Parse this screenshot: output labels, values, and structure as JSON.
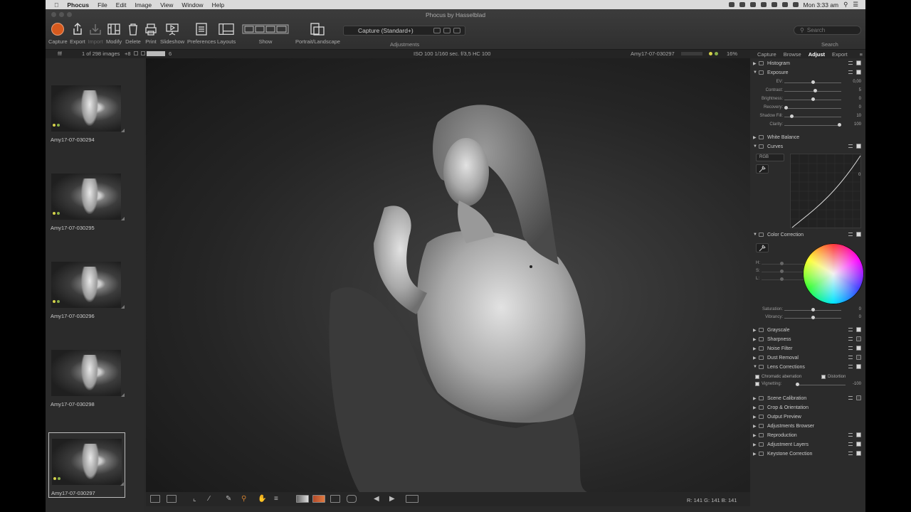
{
  "menubar": {
    "apple": "",
    "items": [
      "Phocus",
      "File",
      "Edit",
      "Image",
      "View",
      "Window",
      "Help"
    ],
    "clock": "Mon 3:33 am"
  },
  "window": {
    "title": "Phocus by Hasselblad"
  },
  "toolbar": {
    "capture": "Capture",
    "export": "Export",
    "import": "Import",
    "modify": "Modify",
    "delete": "Delete",
    "print": "Print",
    "slideshow": "Slideshow",
    "preferences": "Preferences",
    "layouts": "Layouts",
    "show": "Show",
    "portrait_landscape": "Portrait/Landscape",
    "preset": "Capture (Standard+)",
    "adjustments": "Adjustments",
    "search_placeholder": "Search",
    "search_label": "Search",
    "accent": "#d75a1e"
  },
  "infobar": {
    "folder": "fff",
    "count": "1 of 298 images",
    "plus": "+8",
    "six": "6",
    "exif": "ISO 100  1/160 sec. f/3,5  HC 100",
    "filename": "Amy17-07-030297",
    "zoom": "16%"
  },
  "browser": {
    "thumbs": [
      {
        "name": "Amy17-07-030294"
      },
      {
        "name": "Amy17-07-030295"
      },
      {
        "name": "Amy17-07-030296"
      },
      {
        "name": "Amy17-07-030298"
      },
      {
        "name": "Amy17-07-030297"
      }
    ]
  },
  "readout": {
    "r": "141",
    "g": "141",
    "b": "141",
    "text": "R: 141  G: 141  B: 141"
  },
  "panel": {
    "tabs": [
      "Capture",
      "Browse",
      "Adjust",
      "Export"
    ],
    "histogram": "Histogram",
    "exposure": "Exposure",
    "sliders": [
      {
        "name": "EV:",
        "value": "0,00",
        "pos": 0.5
      },
      {
        "name": "Contrast:",
        "value": "5",
        "pos": 0.55
      },
      {
        "name": "Brightness:",
        "value": "0",
        "pos": 0.5
      },
      {
        "name": "Recovery:",
        "value": "0",
        "pos": 0.0
      },
      {
        "name": "Shadow Fill:",
        "value": "10",
        "pos": 0.1
      },
      {
        "name": "Clarity:",
        "value": "100",
        "pos": 1.0
      }
    ],
    "white_balance": "White Balance",
    "curves": "Curves",
    "curve_channel": "RGB",
    "curve_zero": "0",
    "color_correction": "Color Correction",
    "hsl": [
      "H:",
      "S:",
      "L:"
    ],
    "saturation": {
      "name": "Saturation:",
      "value": "0",
      "pos": 0.5
    },
    "vibrancy": {
      "name": "Vibrancy:",
      "value": "0",
      "pos": 0.5
    },
    "grayscale": "Grayscale",
    "sharpness": "Sharpness",
    "noise_filter": "Noise Filter",
    "dust_removal": "Dust Removal",
    "lens_corrections": "Lens Corrections",
    "chromatic": "Chromatic aberration",
    "distortion": "Distortion",
    "vignetting": {
      "name": "Vignetting:",
      "value": "-100",
      "pos": 0.0
    },
    "scene_calibration": "Scene Calibration",
    "crop_orientation": "Crop & Orientation",
    "output_preview": "Output Preview",
    "adjustments_browser": "Adjustments Browser",
    "reproduction": "Reproduction",
    "adjustment_layers": "Adjustment Layers",
    "keystone": "Keystone Correction"
  }
}
